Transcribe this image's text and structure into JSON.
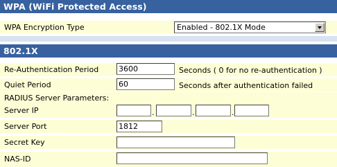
{
  "wpa": {
    "title": "WPA (WiFi Protected Access)",
    "encryption_label": "WPA Encryption Type",
    "encryption_value": "Enabled - 802.1X Mode"
  },
  "dot1x": {
    "title": "802.1X",
    "reauth_label": "Re-Authentication Period",
    "reauth_value": "3600",
    "reauth_hint": "Seconds ( 0 for no re-authentication )",
    "quiet_label": "Quiet Period",
    "quiet_value": "60",
    "quiet_hint": "Seconds after authentication failed",
    "radius_label": "RADIUS Server Parameters:",
    "server_ip_label": "Server IP",
    "server_ip_octets": [
      "",
      "",
      "",
      ""
    ],
    "ip_separator": ".",
    "server_port_label": "Server Port",
    "server_port_value": "1812",
    "secret_key_label": "Secret Key",
    "secret_key_value": "",
    "nas_id_label": "NAS-ID",
    "nas_id_value": ""
  }
}
